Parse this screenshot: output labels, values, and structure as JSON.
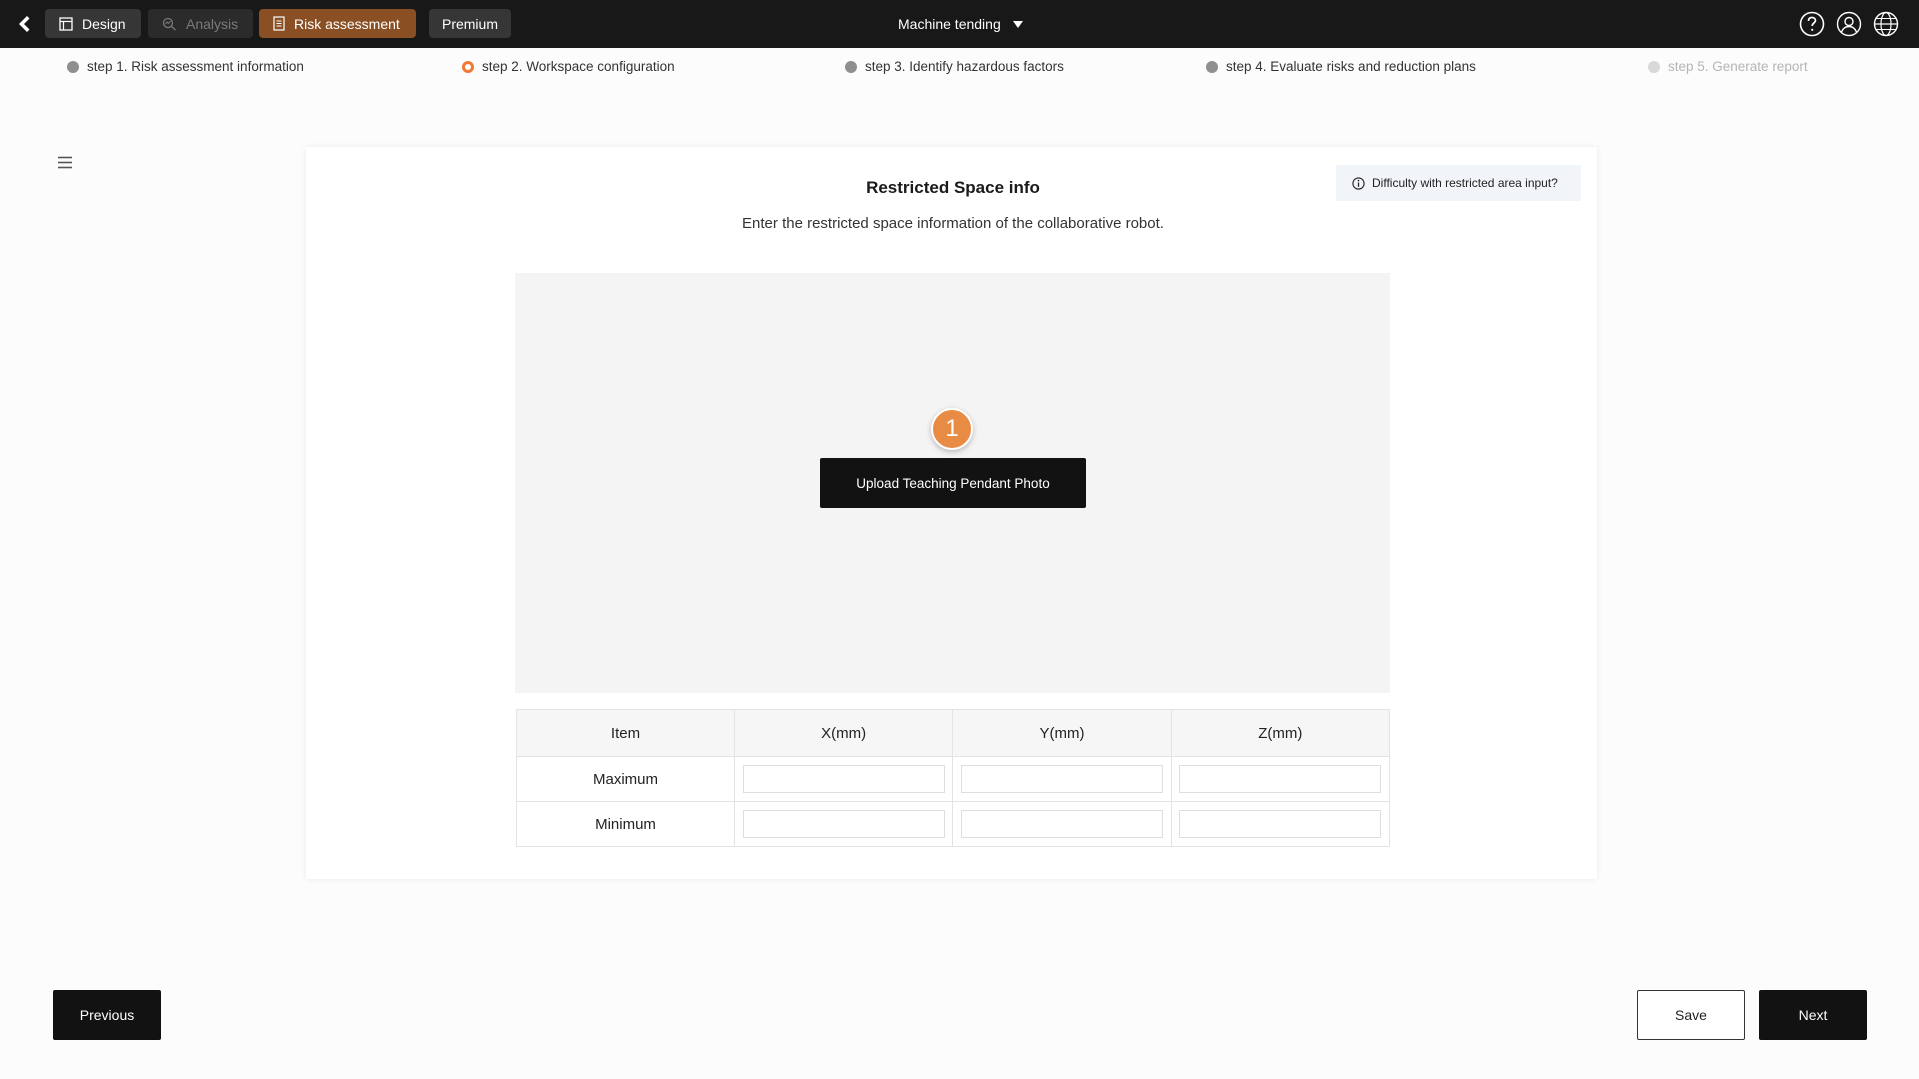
{
  "topbar": {
    "tabs": [
      {
        "label": "Design",
        "icon": "layout-icon"
      },
      {
        "label": "Analysis",
        "icon": "analysis-icon"
      },
      {
        "label": "Risk assessment",
        "icon": "document-icon"
      },
      {
        "label": "Premium"
      }
    ],
    "project": "Machine tending",
    "icons": [
      "help-icon",
      "user-icon",
      "globe-icon"
    ],
    "colors": {
      "bar": "#181818",
      "active_tab": "#8a4f22"
    }
  },
  "steps": [
    {
      "label": "step 1. Risk assessment information",
      "state": "done"
    },
    {
      "label": "step 2. Workspace configuration",
      "state": "active"
    },
    {
      "label": "step 3. Identify hazardous factors",
      "state": "pending"
    },
    {
      "label": "step 4. Evaluate risks and reduction plans",
      "state": "pending"
    },
    {
      "label": "step 5. Generate report",
      "state": "disabled"
    }
  ],
  "main": {
    "title": "Restricted Space info",
    "subtitle": "Enter the restricted space information of the collaborative robot.",
    "help_text": "Difficulty with restricted area input?",
    "marker": "1",
    "upload_label": "Upload Teaching Pendant Photo",
    "accent": "#e78b45"
  },
  "table": {
    "headers": [
      "Item",
      "X(mm)",
      "Y(mm)",
      "Z(mm)"
    ],
    "rows": [
      {
        "label": "Maximum",
        "x": "",
        "y": "",
        "z": ""
      },
      {
        "label": "Minimum",
        "x": "",
        "y": "",
        "z": ""
      }
    ]
  },
  "footer": {
    "previous": "Previous",
    "save": "Save",
    "next": "Next"
  }
}
